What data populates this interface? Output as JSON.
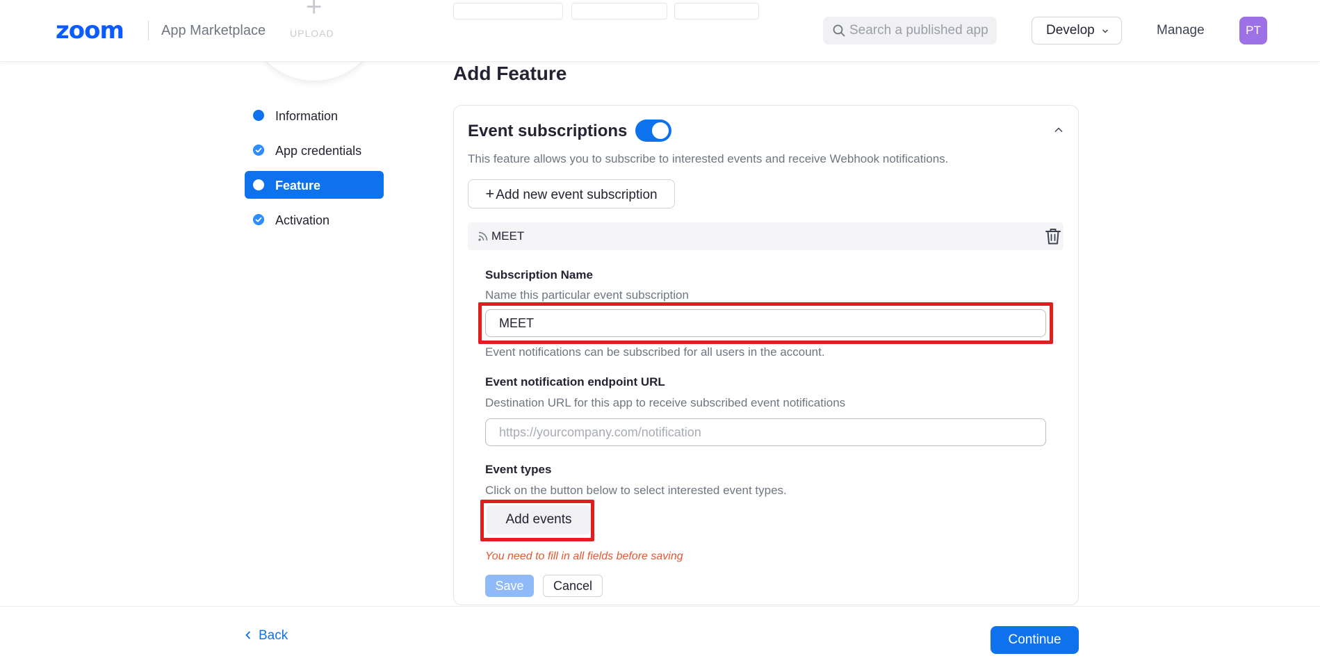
{
  "header": {
    "logo": "zoom",
    "app_title": "App Marketplace",
    "search_placeholder": "Search a published app",
    "develop_label": "Develop",
    "manage_label": "Manage",
    "avatar_initials": "PT"
  },
  "upload": {
    "label": "UPLOAD"
  },
  "steps": [
    {
      "label": "Information",
      "state": "current"
    },
    {
      "label": "App credentials",
      "state": "done"
    },
    {
      "label": "Feature",
      "state": "active"
    },
    {
      "label": "Activation",
      "state": "done"
    }
  ],
  "main": {
    "page_title": "Add Feature",
    "section": {
      "title": "Event subscriptions",
      "enabled": true,
      "description": "This feature allows you to subscribe to interested events and receive Webhook notifications.",
      "add_button": "Add new event subscription",
      "subscription": {
        "name": "MEET",
        "name_label": "Subscription Name",
        "name_hint": "Name this particular event subscription",
        "name_value": "MEET",
        "scope_note": "Event notifications can be subscribed for all users in the account.",
        "endpoint_label": "Event notification endpoint URL",
        "endpoint_hint": "Destination URL for this app to receive subscribed event notifications",
        "endpoint_placeholder": "https://yourcompany.com/notification",
        "event_types_label": "Event types",
        "event_types_hint": "Click on the button below to select interested event types.",
        "add_events_button": "Add events",
        "error": "You need to fill in all fields before saving",
        "save_button": "Save",
        "cancel_button": "Cancel"
      }
    }
  },
  "footer": {
    "back_label": "Back",
    "continue_label": "Continue"
  },
  "colors": {
    "brand": "#0b5cff",
    "accent": "#0e72ed",
    "avatar": "#9d72e6",
    "error": "#e5572e",
    "highlight": "#e01e1e"
  },
  "icons": [
    "search-icon",
    "chevron-down-icon",
    "check-icon",
    "chevron-up-icon",
    "rss-icon",
    "trash-icon",
    "chevron-left-icon"
  ]
}
